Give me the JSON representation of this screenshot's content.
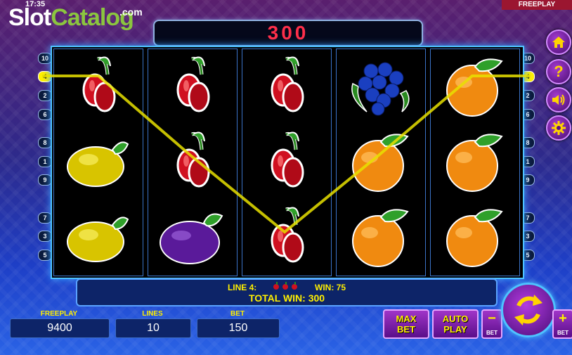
{
  "status_bar": {
    "time": "17:35",
    "mode_tag": "FREEPLAY"
  },
  "watermark": {
    "part1": "Slot",
    "part2": "Catalog",
    "part3": ".com"
  },
  "win_display": "300",
  "line_numbers_left": [
    "10",
    "4",
    "2",
    "6",
    "8",
    "1",
    "9",
    "7",
    "3",
    "5"
  ],
  "line_numbers_right": [
    "10",
    "4",
    "2",
    "6",
    "8",
    "1",
    "9",
    "7",
    "3",
    "5"
  ],
  "active_line": "4",
  "reels": [
    [
      "cherry",
      "lemon",
      "lemon"
    ],
    [
      "cherry",
      "cherry",
      "plum"
    ],
    [
      "cherry",
      "cherry",
      "cherry"
    ],
    [
      "grapes",
      "orange",
      "orange"
    ],
    [
      "orange",
      "orange",
      "orange"
    ]
  ],
  "side_buttons": [
    {
      "icon": "home-icon"
    },
    {
      "icon": "help-icon"
    },
    {
      "icon": "sound-icon"
    },
    {
      "icon": "settings-icon"
    }
  ],
  "info": {
    "line_label": "LINE 4:",
    "win_label": "WIN: 75",
    "total_win": "TOTAL WIN: 300"
  },
  "stats": {
    "freeplay_label": "FREEPLAY",
    "freeplay_value": "9400",
    "lines_label": "LINES",
    "lines_value": "10",
    "bet_label": "BET",
    "bet_value": "150"
  },
  "buttons": {
    "max_bet_line1": "MAX",
    "max_bet_line2": "BET",
    "auto_play_line1": "AUTO",
    "auto_play_line2": "PLAY",
    "bet_minus_symbol": "−",
    "bet_minus_label": "BET",
    "bet_plus_symbol": "+",
    "bet_plus_label": "BET"
  },
  "colors": {
    "accent_yellow": "#ffef00",
    "win_red": "#ff2f4a",
    "frame_blue": "#4ec3ff",
    "button_purple": "#8a2bb8"
  }
}
